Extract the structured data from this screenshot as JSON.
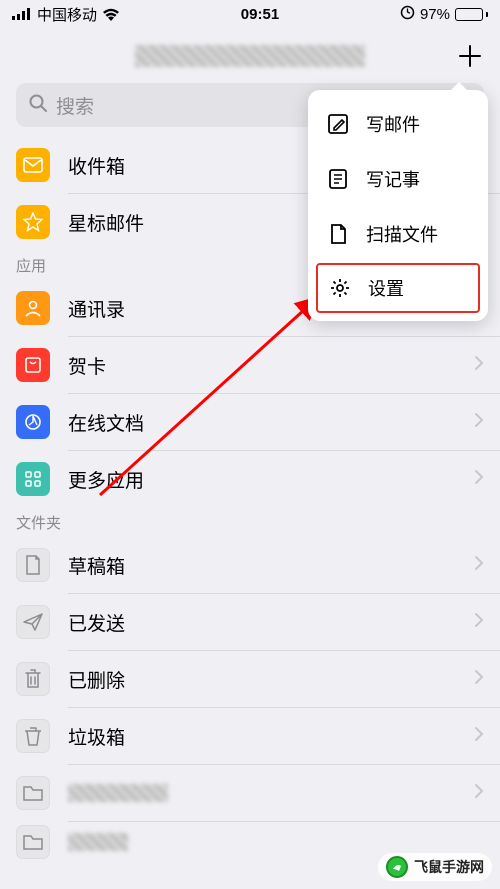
{
  "status": {
    "carrier": "中国移动",
    "time": "09:51",
    "battery_pct": "97%"
  },
  "header": {},
  "search": {
    "placeholder": "搜索"
  },
  "mailbox": {
    "inbox": "收件箱",
    "star": "星标邮件"
  },
  "section_app": "应用",
  "apps": {
    "contacts": "通讯录",
    "card": "贺卡",
    "doc": "在线文档",
    "more": "更多应用"
  },
  "section_folders": "文件夹",
  "folders": {
    "drafts": "草稿箱",
    "sent": "已发送",
    "deleted": "已删除",
    "trash": "垃圾箱"
  },
  "dropdown": {
    "compose": "写邮件",
    "note": "写记事",
    "scan": "扫描文件",
    "settings": "设置"
  },
  "watermark": "飞鼠手游网"
}
